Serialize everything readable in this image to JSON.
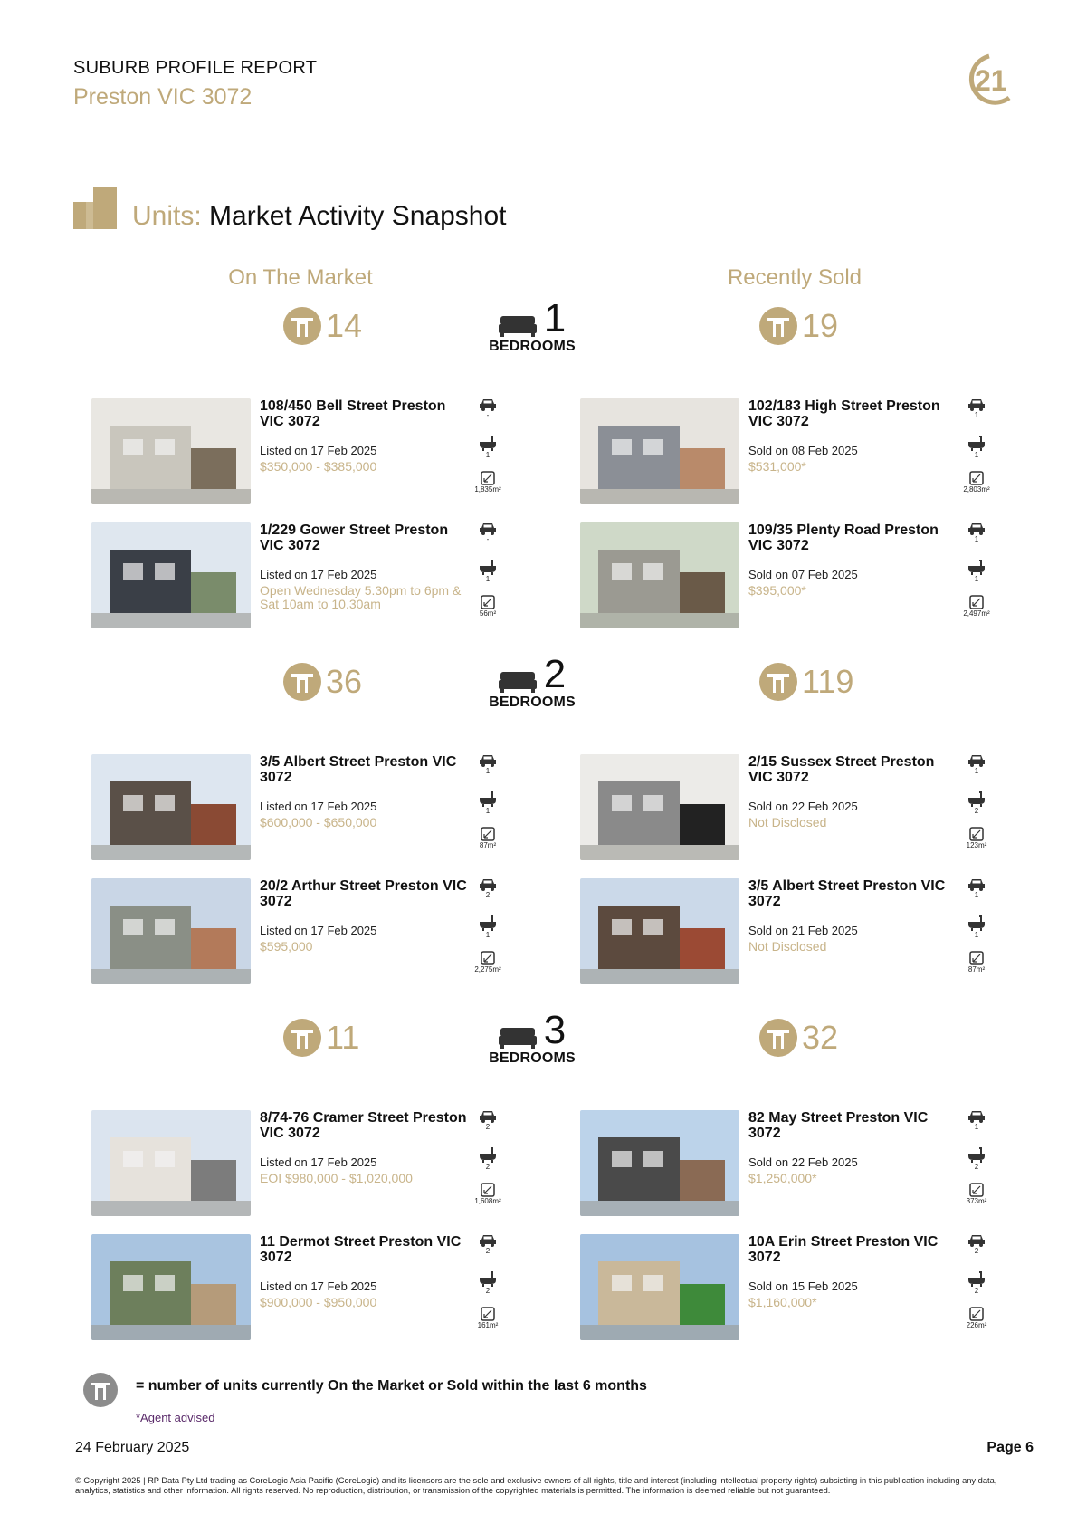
{
  "header": {
    "report_title": "SUBURB PROFILE REPORT",
    "suburb": "Preston VIC 3072",
    "logo": "century-21-logo"
  },
  "section": {
    "prefix": "Units:",
    "title": "Market Activity Snapshot"
  },
  "columns": {
    "left": "On The Market",
    "right": "Recently Sold"
  },
  "groups": [
    {
      "bedrooms": "1",
      "bedrooms_label": "BEDROOMS",
      "on_market_count": "14",
      "sold_count": "19",
      "on_market": [
        {
          "address": "108/450 Bell Street Preston VIC 3072",
          "date": "Listed on 17 Feb 2025",
          "price": "$350,000 - $385,000",
          "cars": "-",
          "baths": "1",
          "area": "1,835m²"
        },
        {
          "address": "1/229 Gower Street Preston VIC 3072",
          "date": "Listed on 17 Feb 2025",
          "price": "Open Wednesday 5.30pm to 6pm & Sat 10am to 10.30am",
          "cars": "-",
          "baths": "1",
          "area": "56m²"
        }
      ],
      "sold": [
        {
          "address": "102/183 High Street Preston VIC 3072",
          "date": "Sold on 08 Feb 2025",
          "price": "$531,000*",
          "cars": "1",
          "baths": "1",
          "area": "2,803m²"
        },
        {
          "address": "109/35 Plenty Road Preston VIC 3072",
          "date": "Sold on 07 Feb 2025",
          "price": "$395,000*",
          "cars": "1",
          "baths": "1",
          "area": "2,497m²"
        }
      ]
    },
    {
      "bedrooms": "2",
      "bedrooms_label": "BEDROOMS",
      "on_market_count": "36",
      "sold_count": "119",
      "on_market": [
        {
          "address": "3/5 Albert Street Preston VIC 3072",
          "date": "Listed on 17 Feb 2025",
          "price": "$600,000 - $650,000",
          "cars": "1",
          "baths": "1",
          "area": "87m²"
        },
        {
          "address": "20/2 Arthur Street Preston VIC 3072",
          "date": "Listed on 17 Feb 2025",
          "price": "$595,000",
          "cars": "2",
          "baths": "1",
          "area": "2,275m²"
        }
      ],
      "sold": [
        {
          "address": "2/15 Sussex Street Preston VIC 3072",
          "date": "Sold on 22 Feb 2025",
          "price": "Not Disclosed",
          "cars": "1",
          "baths": "2",
          "area": "123m²"
        },
        {
          "address": "3/5 Albert Street Preston VIC 3072",
          "date": "Sold on 21 Feb 2025",
          "price": "Not Disclosed",
          "cars": "1",
          "baths": "1",
          "area": "87m²"
        }
      ]
    },
    {
      "bedrooms": "3",
      "bedrooms_label": "BEDROOMS",
      "on_market_count": "11",
      "sold_count": "32",
      "on_market": [
        {
          "address": "8/74-76 Cramer Street Preston VIC 3072",
          "date": "Listed on 17 Feb 2025",
          "price": "EOI $980,000 - $1,020,000",
          "cars": "2",
          "baths": "2",
          "area": "1,608m²"
        },
        {
          "address": "11 Dermot Street Preston VIC 3072",
          "date": "Listed on 17 Feb 2025",
          "price": "$900,000 - $950,000",
          "cars": "2",
          "baths": "2",
          "area": "161m²"
        }
      ],
      "sold": [
        {
          "address": "82 May Street Preston VIC 3072",
          "date": "Sold on 22 Feb 2025",
          "price": "$1,250,000*",
          "cars": "1",
          "baths": "2",
          "area": "373m²"
        },
        {
          "address": "10A Erin Street Preston VIC 3072",
          "date": "Sold on 15 Feb 2025",
          "price": "$1,160,000*",
          "cars": "2",
          "baths": "2",
          "area": "226m²"
        }
      ]
    }
  ],
  "legend": {
    "text": "= number of units currently On the Market or Sold within the last 6 months",
    "agent_note": "*Agent advised"
  },
  "footer": {
    "date": "24 February  2025",
    "page": "Page 6",
    "copyright": "© Copyright 2025 | RP Data Pty Ltd trading as CoreLogic Asia Pacific (CoreLogic) and its licensors are the sole and exclusive owners of all rights, title and interest (including intellectual property rights) subsisting in this publication including any data, analytics, statistics and other information. All rights reserved. No reproduction, distribution, or transmission of the copyrighted materials is permitted. The information is deemed reliable but not guaranteed."
  },
  "colors": {
    "gold": "#bfa97a",
    "text": "#111111",
    "agent_note": "#5a2a6a"
  }
}
